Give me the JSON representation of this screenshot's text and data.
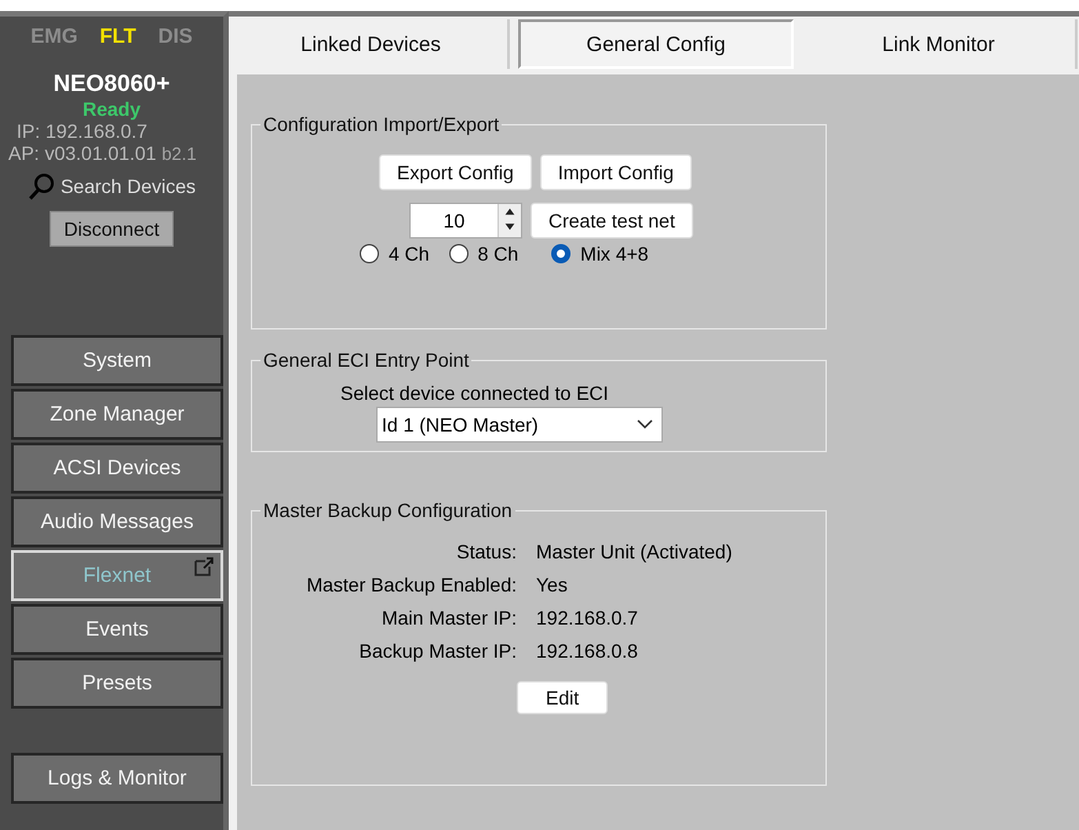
{
  "indicators": [
    {
      "label": "EMG",
      "on": false
    },
    {
      "label": "FLT",
      "on": true
    },
    {
      "label": "DIS",
      "on": false
    }
  ],
  "device": {
    "name": "NEO8060+",
    "status": "Ready",
    "ip": "IP: 192.168.0.7",
    "version": "AP: v03.01.01.01",
    "build": "b2.1"
  },
  "search_devices": "Search Devices",
  "disconnect": "Disconnect",
  "nav": [
    {
      "label": "System",
      "selected": false
    },
    {
      "label": "Zone Manager",
      "selected": false
    },
    {
      "label": "ACSI Devices",
      "selected": false
    },
    {
      "label": "Audio Messages",
      "selected": false
    },
    {
      "label": "Flexnet",
      "selected": true
    },
    {
      "label": "Events",
      "selected": false
    },
    {
      "label": "Presets",
      "selected": false
    }
  ],
  "nav_bottom": {
    "label": "Logs & Monitor",
    "selected": false
  },
  "tabs": [
    {
      "label": "Linked Devices",
      "selected": false
    },
    {
      "label": "General Config",
      "selected": true
    },
    {
      "label": "Link Monitor",
      "selected": false
    }
  ],
  "config_group": {
    "title": "Configuration Import/Export",
    "export": "Export Config",
    "import": "Import Config",
    "count": "10",
    "create": "Create test net",
    "radios": [
      {
        "label": "4 Ch",
        "selected": false
      },
      {
        "label": "8 Ch",
        "selected": false
      },
      {
        "label": "Mix 4+8",
        "selected": true
      }
    ]
  },
  "eci_group": {
    "title": "General ECI Entry Point",
    "label": "Select device connected to ECI",
    "value": "Id 1 (NEO Master)"
  },
  "backup_group": {
    "title": "Master Backup Configuration",
    "rows": [
      {
        "label": "Status:",
        "value": "Master Unit (Activated)"
      },
      {
        "label": "Master Backup Enabled:",
        "value": "Yes"
      },
      {
        "label": "Main Master IP:",
        "value": "192.168.0.7"
      },
      {
        "label": "Backup Master IP:",
        "value": "192.168.0.8"
      }
    ],
    "edit": "Edit"
  }
}
